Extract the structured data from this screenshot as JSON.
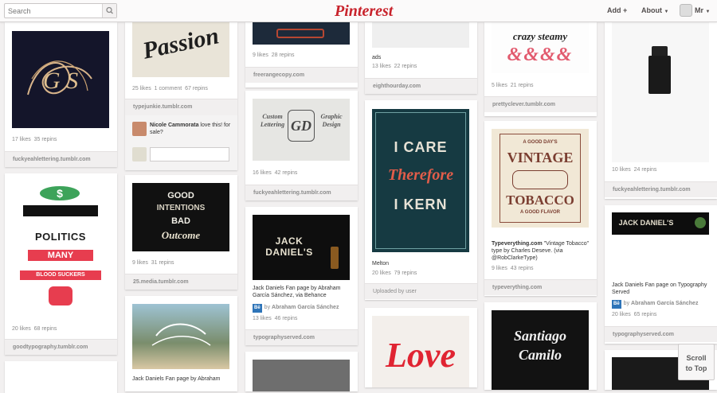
{
  "header": {
    "search_placeholder": "Search",
    "logo": "Pinterest",
    "nav": {
      "add": "Add",
      "add_mark": "+",
      "about": "About",
      "user": "Mr"
    }
  },
  "pins": {
    "c1a": {
      "likes": "17 likes",
      "repins": "35 repins",
      "source": "fuckyeahlettering.tumblr.com"
    },
    "c1b": {
      "art": {
        "l1": "POLITICS",
        "l2": "MANY",
        "l3": "BLOOD SUCKERS"
      },
      "likes": "20 likes",
      "repins": "68 repins",
      "source": "goodtypography.tumblr.com"
    },
    "c2a": {
      "art": "Passion",
      "likes": "25 likes",
      "comments": "1 comment",
      "repins": "67 repins",
      "source": "typejunkie.tumblr.com",
      "comment_name": "Nicole Cammorata",
      "comment_text": "love this! for sale?"
    },
    "c2b": {
      "art": {
        "l1": "GOOD",
        "l2": "INTENTIONS",
        "l3": "BAD",
        "l4": "Outcome"
      },
      "likes": "9 likes",
      "repins": "31 repins",
      "source": "25.media.tumblr.com"
    },
    "c2c": {
      "desc": "Jack Daniels Fan page by Abraham"
    },
    "c3a": {
      "likes": "9 likes",
      "repins": "28 repins",
      "source": "freerangecopy.com"
    },
    "c3b": {
      "art": {
        "l1": "Custom",
        "l2": "Lettering",
        "l3": "Graphic",
        "l4": "Design"
      },
      "likes": "16 likes",
      "repins": "42 repins",
      "source": "fuckyeahlettering.tumblr.com"
    },
    "c3c": {
      "art": "JACK DANIEL'S",
      "desc": "Jack Daniels Fan page by Abraham García Sánchez, via Behance",
      "be": "Bē",
      "by": "by",
      "attribution": "Abraham García Sánchez",
      "likes": "13 likes",
      "repins": "46 repins",
      "source": "typographyserved.com"
    },
    "c4a": {
      "desc": "ads",
      "likes": "13 likes",
      "repins": "22 repins",
      "source": "eighthourday.com"
    },
    "c4b": {
      "art": {
        "l1": "I CARE",
        "l2": "Therefore",
        "l3": "I KERN"
      },
      "desc": "Melton",
      "likes": "20 likes",
      "repins": "79 repins",
      "source": "Uploaded by user"
    },
    "c4c": {
      "art": "Love"
    },
    "c5a": {
      "art": {
        "l1": "crazy steamy",
        "l2": "&&&&"
      },
      "likes": "5 likes",
      "repins": "21 repins",
      "source": "prettyclever.tumblr.com"
    },
    "c5b": {
      "art": {
        "l1": "A GOOD DAY'S",
        "l2": "VINTAGE",
        "l3": "TOBACCO",
        "l4": "A GOOD FLAVOR"
      },
      "desc_bold": "Typeverything.com",
      "desc": " \"Vintage Tobacco\" type by Charles Deseve. (via @RobClarkeType)",
      "likes": "9 likes",
      "repins": "43 repins",
      "source": "typeverything.com"
    },
    "c5c": {
      "art": {
        "l1": "Santiago",
        "l2": "Camilo"
      }
    },
    "c6a": {
      "likes": "10 likes",
      "repins": "24 repins",
      "source": "fuckyeahlettering.tumblr.com"
    },
    "c6b": {
      "desc": "Jack Daniels Fan page on Typography Served",
      "be": "Bē",
      "by": "by",
      "attribution": "Abraham García Sánchez",
      "likes": "20 likes",
      "repins": "65 repins",
      "source": "typographyserved.com"
    }
  },
  "scroll_top": {
    "l1": "Scroll",
    "l2": "to Top"
  }
}
